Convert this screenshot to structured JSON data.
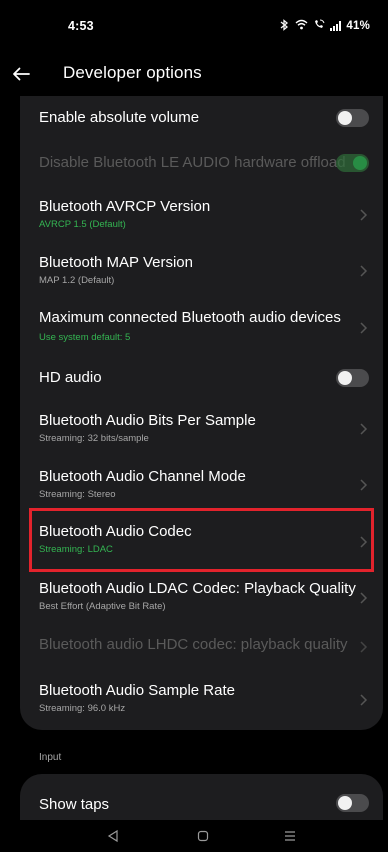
{
  "status_bar": {
    "time": "4:53",
    "battery": "41%",
    "icons": [
      "bluetooth-icon",
      "wifi-icon",
      "call-wifi-icon",
      "signal-icon"
    ]
  },
  "app_bar": {
    "back_icon": "back-arrow-icon",
    "title": "Developer options"
  },
  "settings": [
    {
      "id": "enable-absolute-volume",
      "title": "Enable absolute volume",
      "summary": "",
      "control": "toggle",
      "on": false,
      "disabled": false
    },
    {
      "id": "disable-le-audio-offload",
      "title": "Disable Bluetooth LE AUDIO hardware offload",
      "summary": "",
      "control": "toggle",
      "on": true,
      "disabled": true
    },
    {
      "id": "avrcp-version",
      "title": "Bluetooth AVRCP Version",
      "summary": "AVRCP 1.5 (Default)",
      "summary_color": "green",
      "control": "chevron",
      "disabled": false
    },
    {
      "id": "map-version",
      "title": "Bluetooth MAP Version",
      "summary": "MAP 1.2 (Default)",
      "summary_color": "gray",
      "control": "chevron",
      "disabled": false
    },
    {
      "id": "max-connected-devices",
      "title": "Maximum connected Bluetooth audio devices",
      "summary": "Use system default: 5",
      "summary_color": "green",
      "control": "chevron",
      "disabled": false
    },
    {
      "id": "hd-audio",
      "title": "HD audio",
      "summary": "",
      "control": "toggle",
      "on": false,
      "disabled": false
    },
    {
      "id": "bits-per-sample",
      "title": "Bluetooth Audio Bits Per Sample",
      "summary": "Streaming: 32 bits/sample",
      "summary_color": "gray",
      "control": "chevron",
      "disabled": false
    },
    {
      "id": "channel-mode",
      "title": "Bluetooth Audio Channel Mode",
      "summary": "Streaming: Stereo",
      "summary_color": "gray",
      "control": "chevron",
      "disabled": false
    },
    {
      "id": "audio-codec",
      "title": "Bluetooth Audio Codec",
      "summary": "Streaming: LDAC",
      "summary_color": "green",
      "control": "chevron",
      "disabled": false,
      "highlighted": true
    },
    {
      "id": "ldac-quality",
      "title": "Bluetooth Audio LDAC Codec: Playback Quality",
      "summary": "Best Effort (Adaptive Bit Rate)",
      "summary_color": "gray",
      "control": "chevron",
      "disabled": false
    },
    {
      "id": "lhdc-quality",
      "title": "Bluetooth audio LHDC codec: playback quality",
      "summary": "",
      "control": "chevron",
      "disabled": true
    },
    {
      "id": "sample-rate",
      "title": "Bluetooth Audio Sample Rate",
      "summary": "Streaming: 96.0 kHz",
      "summary_color": "gray",
      "control": "chevron",
      "disabled": false
    }
  ],
  "input_section": {
    "label": "Input",
    "show_taps": {
      "title": "Show taps",
      "control": "toggle",
      "on": false
    }
  },
  "nav_bar": {
    "icons": [
      "back-triangle-icon",
      "home-square-icon",
      "recents-lines-icon"
    ]
  },
  "colors": {
    "background": "#000000",
    "card": "#1d1d1f",
    "accent_green": "#34b552",
    "highlight_red": "#e3232c",
    "disabled_text": "#5a5a5a",
    "secondary_text": "#a7a7a7"
  }
}
